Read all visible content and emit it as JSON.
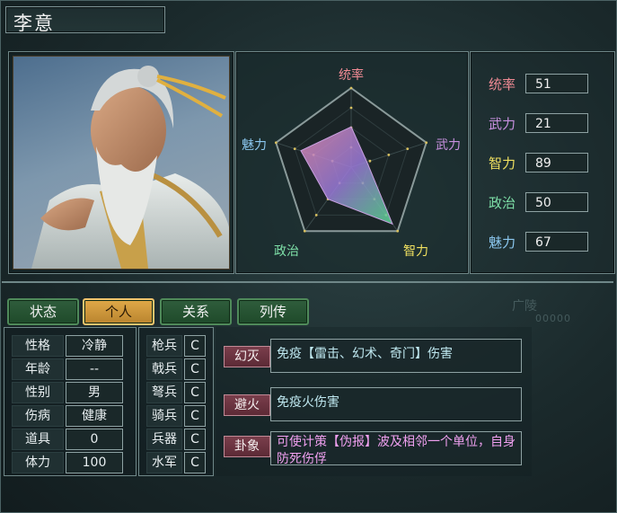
{
  "window": {
    "title": "李意"
  },
  "radar": {
    "labels": {
      "leadership": "统率",
      "war": "武力",
      "intelligence": "智力",
      "politics": "政治",
      "charm": "魅力"
    },
    "colors": {
      "leadership": "#f08a94",
      "war": "#c890e0",
      "intelligence": "#f0e060",
      "politics": "#7ee0a8",
      "charm": "#8cc8f0"
    },
    "values": {
      "leadership": 51,
      "war": 21,
      "intelligence": 89,
      "politics": 50,
      "charm": 67
    },
    "max": 100
  },
  "stats": [
    {
      "label": "统率",
      "value": "51",
      "color": "#f08a94"
    },
    {
      "label": "武力",
      "value": "21",
      "color": "#c890e0"
    },
    {
      "label": "智力",
      "value": "89",
      "color": "#f0e060"
    },
    {
      "label": "政治",
      "value": "50",
      "color": "#7ee0a8"
    },
    {
      "label": "魅力",
      "value": "67",
      "color": "#8cc8f0"
    }
  ],
  "tabs": [
    {
      "label": "状态",
      "active": false
    },
    {
      "label": "个人",
      "active": true
    },
    {
      "label": "关系",
      "active": false
    },
    {
      "label": "列传",
      "active": false
    }
  ],
  "personal": [
    {
      "label": "性格",
      "value": "冷静"
    },
    {
      "label": "年龄",
      "value": "--"
    },
    {
      "label": "性别",
      "value": "男"
    },
    {
      "label": "伤病",
      "value": "健康"
    },
    {
      "label": "道具",
      "value": "0"
    },
    {
      "label": "体力",
      "value": "100"
    }
  ],
  "troops": [
    {
      "label": "枪兵",
      "value": "C"
    },
    {
      "label": "戟兵",
      "value": "C"
    },
    {
      "label": "弩兵",
      "value": "C"
    },
    {
      "label": "骑兵",
      "value": "C"
    },
    {
      "label": "兵器",
      "value": "C"
    },
    {
      "label": "水军",
      "value": "C"
    }
  ],
  "skills": [
    {
      "name": "幻灭",
      "desc": "免疫【雷击、幻术、奇门】伤害"
    },
    {
      "name": "避火",
      "desc": "免疫火伤害"
    },
    {
      "name": "卦象",
      "desc": "可使计策【伪报】波及相邻一个单位，自身防死伤俘"
    }
  ],
  "background_map": {
    "city": "广陵",
    "number": "00000"
  }
}
